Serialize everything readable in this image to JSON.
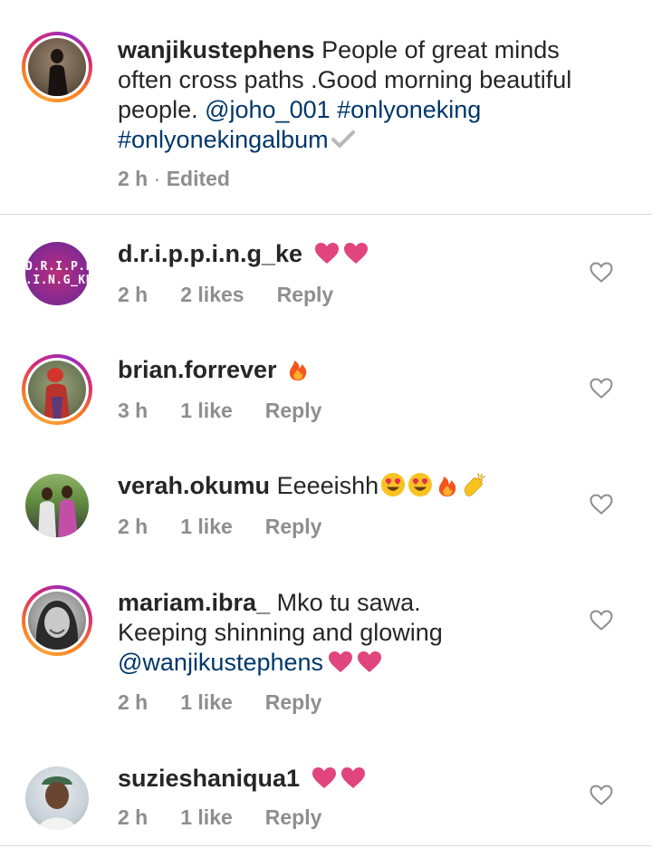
{
  "caption": {
    "username": "wanjikustephens",
    "text_line1": " People of great  minds",
    "text_line2": "often cross paths .Good morning beautiful",
    "text_line3_pre": "people. ",
    "mention": "@joho_001",
    "tag1": "#onlyoneking",
    "tag2": "#onlyonekingalbum",
    "time": "2 h",
    "separator": " · ",
    "edited": "Edited"
  },
  "comments": [
    {
      "username": "d.r.i.p.p.i.n.g_ke",
      "avatar_text_line1": "D.R.I.P.P",
      "avatar_text_line2": ".I.N.G_KE",
      "time": "2 h",
      "likes": "2 likes",
      "reply": "Reply"
    },
    {
      "username": "brian.forrever",
      "time": "3 h",
      "likes": "1 like",
      "reply": "Reply"
    },
    {
      "username": "verah.okumu",
      "text": " Eeeeishh",
      "time": "2 h",
      "likes": "1 like",
      "reply": "Reply"
    },
    {
      "username": "mariam.ibra_",
      "text_line1": " Mko tu sawa.",
      "text_line2": "Keeping  shinning  and  glowing",
      "mention": "@wanjikustephens",
      "time": "2 h",
      "likes": "1 like",
      "reply": "Reply"
    },
    {
      "username": "suzieshaniqua1",
      "time": "2 h",
      "likes": "1 like",
      "reply": "Reply"
    }
  ],
  "colors": {
    "text": "#262626",
    "muted": "#8e8e8e",
    "link": "#00376b",
    "heart_emoji": "#e0457b",
    "divider": "#dbdbdb"
  },
  "icons": [
    "heart-outline-icon",
    "heart-emoji-icon",
    "fire-emoji-icon",
    "heart-eyes-emoji-icon",
    "clapping-hands-emoji-icon",
    "verified-check-icon"
  ]
}
